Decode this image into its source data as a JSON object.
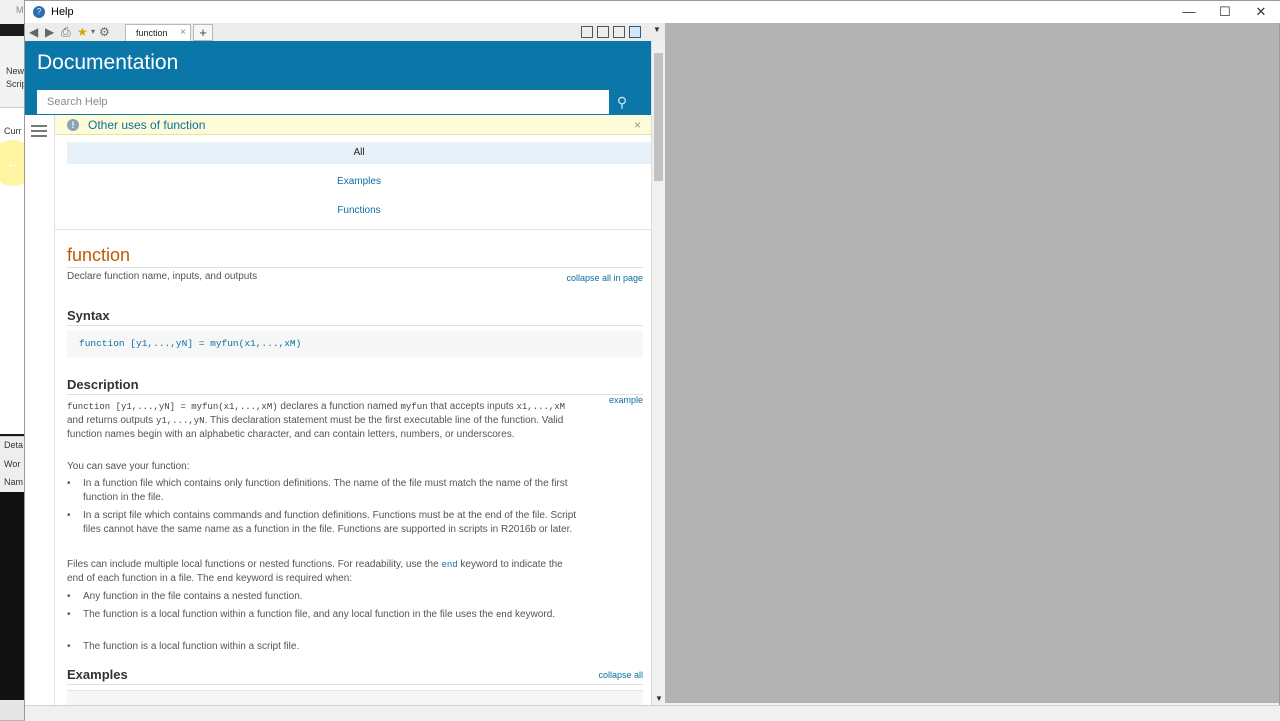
{
  "background_app": {
    "labels": [
      "M",
      "New",
      "Scrip",
      "Curr",
      "Deta",
      "Wor",
      "Nam"
    ]
  },
  "window": {
    "title": "Help",
    "controls": {
      "minimize": "—",
      "maximize": "☐",
      "close": "✕"
    }
  },
  "toolbar": {
    "tab_label": "function",
    "tab_close": "×",
    "add_tab": "+"
  },
  "doc": {
    "header_title": "Documentation",
    "search_placeholder": "Search Help",
    "notice": "Other uses of function",
    "notice_close": "×",
    "filters": [
      "All",
      "Examples",
      "Functions"
    ],
    "page_title": "function",
    "page_summary": "Declare function name, inputs, and outputs",
    "collapse_all_in_page": "collapse all in page",
    "syntax_heading": "Syntax",
    "syntax_code": "function [y1,...,yN] = myfun(x1,...,xM)",
    "description_heading": "Description",
    "example_link": "example",
    "desc_code1": "function [y1,...,yN] = myfun(x1,...,xM)",
    "desc_text1": " declares a function named ",
    "desc_code2": "myfun",
    "desc_text2": " that accepts inputs ",
    "desc_code3": "x1,...,xM",
    "desc_text3": " and returns outputs ",
    "desc_code4": "y1,...,yN",
    "desc_text4": ". This declaration statement must be the first executable line of the function. Valid function names begin with an alphabetic character, and can contain letters, numbers, or underscores.",
    "save_intro": "You can save your function:",
    "bullet_function_file": "In a function file which contains only function definitions. The name of the file must match the name of the first function in the file.",
    "bullet_script_file": "In a script file which contains commands and function definitions. Functions must be at the end of the file. Script files cannot have the same name as a function in the file. Functions are supported in scripts in R2016b or later.",
    "files_text1": "Files can include multiple local functions or nested functions. For readability, use the ",
    "files_code1": "end",
    "files_text2": " keyword to indicate the end of each function in a file. The ",
    "files_code2": "end",
    "files_text3": " keyword is required when:",
    "nested_bullet_1": "Any function in the file contains a nested function.",
    "nested_bullet_2a": "The function is a local function within a function file, and any local function in the file uses the ",
    "nested_bullet_2_code": "end",
    "nested_bullet_2b": " keyword.",
    "nested_bullet_3": "The function is a local function within a script file.",
    "examples_heading": "Examples",
    "collapse_all": "collapse all",
    "bullet_char": "•"
  },
  "colors": {
    "header_blue": "#0a77a8",
    "link_blue": "#0a6fa1",
    "title_orange": "#c05b00",
    "notice_yellow": "#fefcd8"
  },
  "icons": [
    "back-icon",
    "forward-icon",
    "print-icon",
    "favorite-star-icon",
    "settings-gear-icon",
    "search-icon",
    "info-icon",
    "hamburger-icon",
    "layout-grid-icon",
    "layout-columns-icon",
    "layout-rows-icon",
    "layout-single-icon"
  ]
}
